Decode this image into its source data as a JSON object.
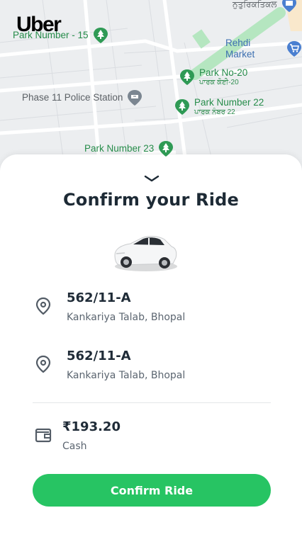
{
  "brand": {
    "logo_text": "Uber"
  },
  "map": {
    "pois": [
      {
        "id": "park15",
        "label": "Park Number - 15",
        "type": "park"
      },
      {
        "id": "rehdi",
        "label": "Rehdi Market",
        "type": "shopping"
      },
      {
        "id": "park20",
        "label": "Park No-20",
        "sublabel": "ਪਾਰਕ ਕੋਈ-20",
        "type": "park"
      },
      {
        "id": "police",
        "label": "Phase 11 Police Station",
        "type": "police"
      },
      {
        "id": "park22",
        "label": "Park Number 22",
        "sublabel": "ਪਾਰਕ ਨੰਬਰ 22",
        "type": "park"
      },
      {
        "id": "park23",
        "label": "Park Number 23",
        "type": "park"
      },
      {
        "id": "top",
        "label": "ਨੁਤੁਰਿਕਤਿਕਲ",
        "type": "shopping"
      }
    ]
  },
  "sheet": {
    "title": "Confirm your Ride",
    "pickup": {
      "title": "562/11-A",
      "subtitle": "Kankariya Talab, Bhopal"
    },
    "destination": {
      "title": "562/11-A",
      "subtitle": "Kankariya Talab, Bhopal"
    },
    "fare": {
      "amount": "₹193.20",
      "method": "Cash"
    },
    "confirm_label": "Confirm Ride"
  },
  "colors": {
    "accent": "#27c463",
    "park": "#2f8e4f",
    "text_dark": "#1d2a35"
  }
}
